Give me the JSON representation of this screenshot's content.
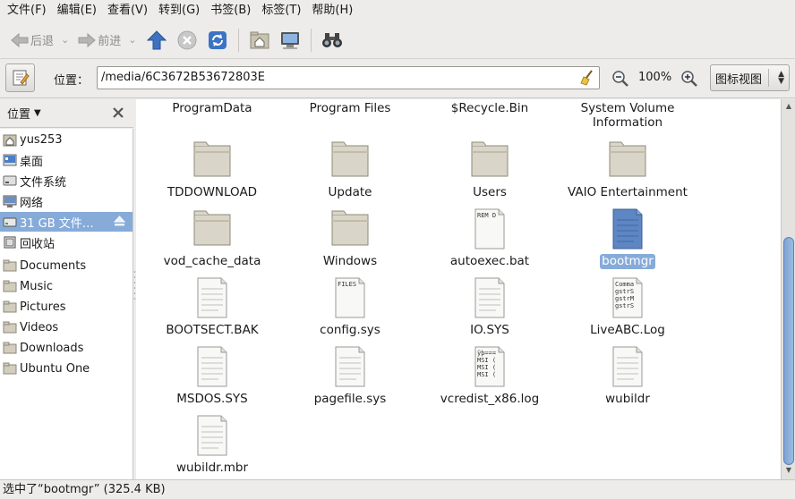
{
  "menubar": {
    "items": [
      "文件(F)",
      "编辑(E)",
      "查看(V)",
      "转到(G)",
      "书签(B)",
      "标签(T)",
      "帮助(H)"
    ]
  },
  "toolbar": {
    "back_label": "后退",
    "forward_label": "前进"
  },
  "location": {
    "label": "位置：",
    "path": "/media/6C3672B53672803E",
    "zoom": "100%",
    "view_mode": "图标视图"
  },
  "sidebar": {
    "header": "位置",
    "items": [
      {
        "label": "yus253",
        "icon": "home-icon"
      },
      {
        "label": "桌面",
        "icon": "desktop-icon"
      },
      {
        "label": "文件系统",
        "icon": "filesystem-icon"
      },
      {
        "label": "网络",
        "icon": "network-icon"
      },
      {
        "label": "31 GB 文件…",
        "icon": "drive-icon",
        "selected": true
      },
      {
        "label": "回收站",
        "icon": "trash-icon"
      },
      {
        "label": "Documents",
        "icon": "folder-icon"
      },
      {
        "label": "Music",
        "icon": "folder-icon"
      },
      {
        "label": "Pictures",
        "icon": "folder-icon"
      },
      {
        "label": "Videos",
        "icon": "folder-icon"
      },
      {
        "label": "Downloads",
        "icon": "folder-icon"
      },
      {
        "label": "Ubuntu One",
        "icon": "folder-icon"
      }
    ]
  },
  "files": [
    {
      "name": "ProgramData",
      "type": "folder-partial"
    },
    {
      "name": "Program Files",
      "type": "folder-partial"
    },
    {
      "name": "$Recycle.Bin",
      "type": "folder-partial"
    },
    {
      "name": "System Volume\nInformation",
      "type": "folder-partial"
    },
    {
      "name": "TDDOWNLOAD",
      "type": "folder"
    },
    {
      "name": "Update",
      "type": "folder"
    },
    {
      "name": "Users",
      "type": "folder"
    },
    {
      "name": "VAIO Entertainment",
      "type": "folder"
    },
    {
      "name": "vod_cache_data",
      "type": "folder"
    },
    {
      "name": "Windows",
      "type": "folder"
    },
    {
      "name": "autoexec.bat",
      "type": "text",
      "preview": "REM D"
    },
    {
      "name": "bootmgr",
      "type": "binary",
      "selected": true
    },
    {
      "name": "BOOTSECT.BAK",
      "type": "doc"
    },
    {
      "name": "config.sys",
      "type": "text",
      "preview": "FILES"
    },
    {
      "name": "IO.SYS",
      "type": "doc"
    },
    {
      "name": "LiveABC.Log",
      "type": "text",
      "preview": "Comma\ngstrS\ngstrM\ngstrS"
    },
    {
      "name": "MSDOS.SYS",
      "type": "doc"
    },
    {
      "name": "pagefile.sys",
      "type": "doc"
    },
    {
      "name": "vcredist_x86.log",
      "type": "text",
      "preview": "ÿþ===\nMSI (\nMSI (\nMSI ("
    },
    {
      "name": "wubildr",
      "type": "doc"
    },
    {
      "name": "wubildr.mbr",
      "type": "doc"
    }
  ],
  "status": "选中了“bootmgr” (325.4 KB)",
  "colors": {
    "selection": "#86abd9",
    "folder": "#d9d5c8",
    "window_bg": "#edeceb"
  }
}
